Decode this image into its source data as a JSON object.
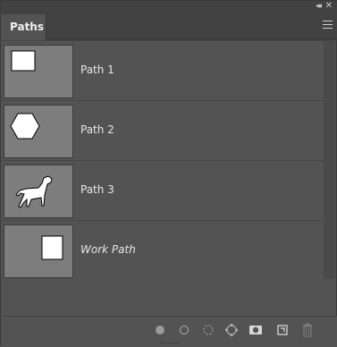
{
  "panel": {
    "tab_label": "Paths",
    "collapse_glyph": "◂◂",
    "close_glyph": "✕"
  },
  "paths": [
    {
      "label": "Path 1",
      "thumbnail": "square-shape",
      "italic": false
    },
    {
      "label": "Path 2",
      "thumbnail": "hexagon-shape",
      "italic": false
    },
    {
      "label": "Path 3",
      "thumbnail": "dog-silhouette",
      "italic": false
    },
    {
      "label": "Work Path",
      "thumbnail": "square-shape",
      "italic": true
    }
  ],
  "footer_icons": [
    "fill-path-icon",
    "stroke-path-icon",
    "load-selection-icon",
    "make-work-path-icon",
    "add-mask-icon",
    "new-path-icon",
    "trash-icon"
  ]
}
